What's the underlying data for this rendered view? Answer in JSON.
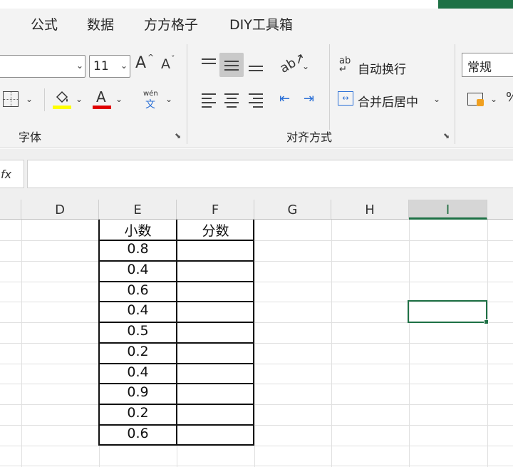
{
  "menu": {
    "tabs": [
      "公式",
      "数据",
      "方方格子",
      "DIY工具箱"
    ]
  },
  "ribbon": {
    "font_size": "11",
    "grow_font_label": "A",
    "shrink_font_label": "A",
    "phonetic_top": "wén",
    "phonetic_bottom": "文",
    "font_color_letter": "A",
    "fill_color": "#ffff00",
    "font_color": "#e00000",
    "wrap_text_label": "自动换行",
    "merge_center_label": "合并后居中",
    "number_format": "常规",
    "group_font_label": "字体",
    "group_align_label": "对齐方式"
  },
  "formula_bar": {
    "fx_label": "fx",
    "value": ""
  },
  "sheet": {
    "columns": [
      "D",
      "E",
      "F",
      "G",
      "H",
      "I"
    ],
    "selected_column": "I",
    "headers": [
      "小数",
      "分数"
    ],
    "decimals": [
      "0.8",
      "0.4",
      "0.6",
      "0.4",
      "0.5",
      "0.2",
      "0.4",
      "0.9",
      "0.2",
      "0.6"
    ],
    "accent_color": "#1e7145"
  }
}
